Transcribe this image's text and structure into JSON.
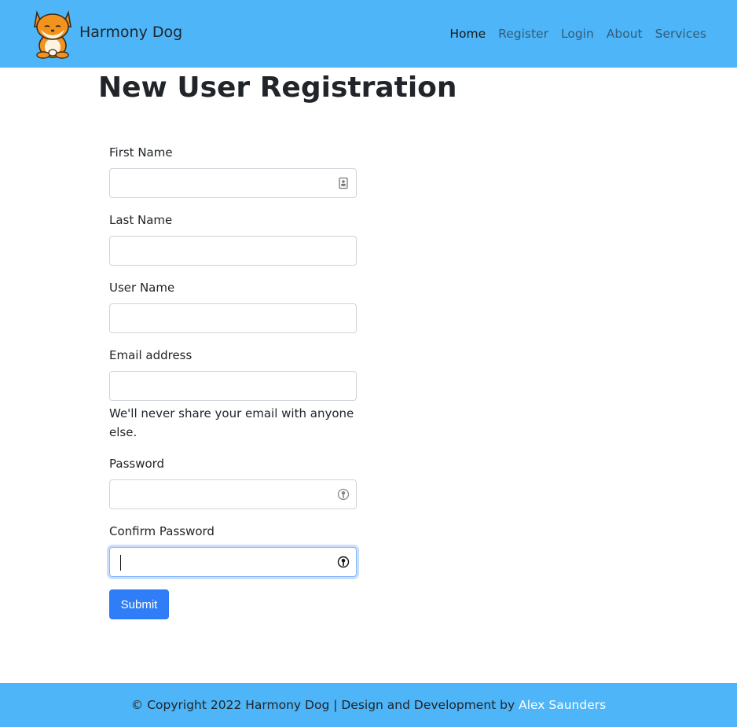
{
  "navbar": {
    "brand_name": "Harmony Dog",
    "links": [
      {
        "label": "Home",
        "active": true
      },
      {
        "label": "Register",
        "active": false
      },
      {
        "label": "Login",
        "active": false
      },
      {
        "label": "About",
        "active": false
      },
      {
        "label": "Services",
        "active": false
      }
    ]
  },
  "main": {
    "title": "New User Registration",
    "form": {
      "first_name": {
        "label": "First Name",
        "value": ""
      },
      "last_name": {
        "label": "Last Name",
        "value": ""
      },
      "user_name": {
        "label": "User Name",
        "value": ""
      },
      "email": {
        "label": "Email address",
        "value": "",
        "help": "We'll never share your email with anyone else."
      },
      "password": {
        "label": "Password",
        "value": ""
      },
      "confirm_password": {
        "label": "Confirm Password",
        "value": ""
      },
      "submit_label": "Submit"
    }
  },
  "footer": {
    "text": "© Copyright 2022 Harmony Dog | Design and Development by",
    "author_link": "Alex Saunders"
  },
  "colors": {
    "navbar_bg": "#4db5f8",
    "footer_bg": "#4db5f8",
    "submit_bg": "#2f7ef7"
  },
  "icons": {
    "brand": "shiba-dog-logo-icon",
    "autofill": "contact-card-icon",
    "password_manager": "key-icon"
  }
}
